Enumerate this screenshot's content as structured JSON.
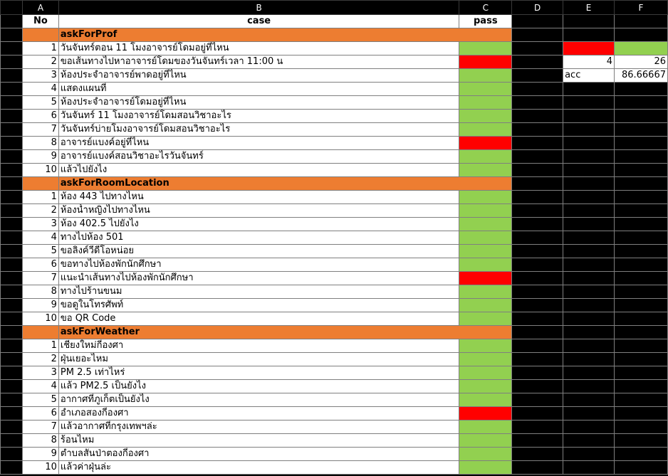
{
  "columns": [
    "A",
    "B",
    "C",
    "D",
    "E",
    "F"
  ],
  "header": {
    "no": "No",
    "case": "case",
    "pass": "pass"
  },
  "sections": [
    {
      "title": "askForProf",
      "rows": [
        {
          "no": 1,
          "case": "วันจันทร์ตอน 11 โมงอาจารย์โดมอยู่ที่ไหน",
          "pass": true
        },
        {
          "no": 2,
          "case": "ขอเส้นทางไปหาอาจารย์โดมของวันจันทร์เวลา 11:00 น",
          "pass": false
        },
        {
          "no": 3,
          "case": "ห้องประจำอาจารย์พาดอยู่ที่ไหน",
          "pass": true
        },
        {
          "no": 4,
          "case": "แสดงแผนที่",
          "pass": true
        },
        {
          "no": 5,
          "case": "ห้องประจำอาจารย์โดมอยู่ที่ไหน",
          "pass": true
        },
        {
          "no": 6,
          "case": "วันจันทร์ 11 โมงอาจารย์โดมสอนวิชาอะไร",
          "pass": true
        },
        {
          "no": 7,
          "case": "วันจันทร์บ่ายโมงอาจารย์โดมสอนวิชาอะไร",
          "pass": true
        },
        {
          "no": 8,
          "case": "อาจารย์แบงค์อยู่ที่ไหน",
          "pass": false
        },
        {
          "no": 9,
          "case": "อาจารย์แบงค์สอนวิชาอะไรวันจันทร์",
          "pass": true
        },
        {
          "no": 10,
          "case": "แล้วไปยังไง",
          "pass": true
        }
      ]
    },
    {
      "title": "askForRoomLocation",
      "rows": [
        {
          "no": 1,
          "case": "ห้อง 443 ไปทางไหน",
          "pass": true
        },
        {
          "no": 2,
          "case": "ห้องน้ำหญิงไปทางไหน",
          "pass": true
        },
        {
          "no": 3,
          "case": "ห้อง 402.5 ไปยังไง",
          "pass": true
        },
        {
          "no": 4,
          "case": "ทางไปห้อง 501",
          "pass": true
        },
        {
          "no": 5,
          "case": "ขอลิงค์วีดีโอหน่อย",
          "pass": true
        },
        {
          "no": 6,
          "case": "ขอทางไปห้องพักนักศึกษา",
          "pass": true
        },
        {
          "no": 7,
          "case": "แนะนำเส้นทางไปห้องพักนักศึกษา",
          "pass": false
        },
        {
          "no": 8,
          "case": "ทางไปร้านขนม",
          "pass": true
        },
        {
          "no": 9,
          "case": "ขอดูในโทรศัพท์",
          "pass": true
        },
        {
          "no": 10,
          "case": "ขอ QR Code",
          "pass": true
        }
      ]
    },
    {
      "title": "askForWeather",
      "rows": [
        {
          "no": 1,
          "case": "เชียงใหม่กี่องศา",
          "pass": true
        },
        {
          "no": 2,
          "case": "ฝุ่นเยอะไหม",
          "pass": true
        },
        {
          "no": 3,
          "case": "PM 2.5 เท่าไหร่",
          "pass": true
        },
        {
          "no": 4,
          "case": "แล้ว PM2.5 เป็นยังไง",
          "pass": true
        },
        {
          "no": 5,
          "case": "อากาศที่ภูเก็ตเป็นยังไง",
          "pass": true
        },
        {
          "no": 6,
          "case": "อำเภอสองกี่องศา",
          "pass": false
        },
        {
          "no": 7,
          "case": "แล้วอากาศที่กรุงเทพฯล่ะ",
          "pass": true
        },
        {
          "no": 8,
          "case": "ร้อนไหม",
          "pass": true
        },
        {
          "no": 9,
          "case": "ตำบลสันป่าตองกี่องศา",
          "pass": true
        },
        {
          "no": 10,
          "case": "แล้วค่าฝุ่นล่ะ",
          "pass": true
        }
      ]
    }
  ],
  "summary": {
    "fail_count": "4",
    "pass_count": "26",
    "acc_label": "acc",
    "acc_value": "86.66667"
  },
  "colors": {
    "pass": "#92d050",
    "fail": "#ff0000",
    "section": "#ed7d31"
  }
}
